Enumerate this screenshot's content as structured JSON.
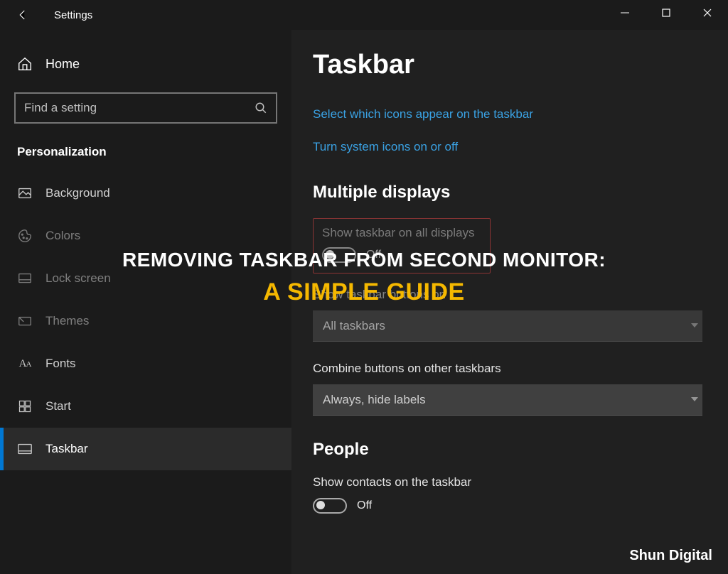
{
  "window": {
    "title": "Settings"
  },
  "sidebar": {
    "home_label": "Home",
    "search_placeholder": "Find a setting",
    "section": "Personalization",
    "items": [
      {
        "label": "Background"
      },
      {
        "label": "Colors"
      },
      {
        "label": "Lock screen"
      },
      {
        "label": "Themes"
      },
      {
        "label": "Fonts"
      },
      {
        "label": "Start"
      },
      {
        "label": "Taskbar"
      }
    ]
  },
  "page": {
    "heading": "Taskbar",
    "links": [
      "Select which icons appear on the taskbar",
      "Turn system icons on or off"
    ],
    "multiple_displays": {
      "heading": "Multiple displays",
      "show_all_label": "Show taskbar on all displays",
      "show_all_state": "Off",
      "show_buttons_label": "Show taskbar buttons on",
      "show_buttons_value": "All taskbars",
      "combine_label": "Combine buttons on other taskbars",
      "combine_value": "Always, hide labels"
    },
    "people": {
      "heading": "People",
      "contacts_label": "Show contacts on the taskbar",
      "contacts_state": "Off"
    }
  },
  "overlay": {
    "line1": "REMOVING TASKBAR FROM SECOND MONITOR:",
    "line2": "A SIMPLE GUIDE"
  },
  "watermark": "Shun Digital"
}
